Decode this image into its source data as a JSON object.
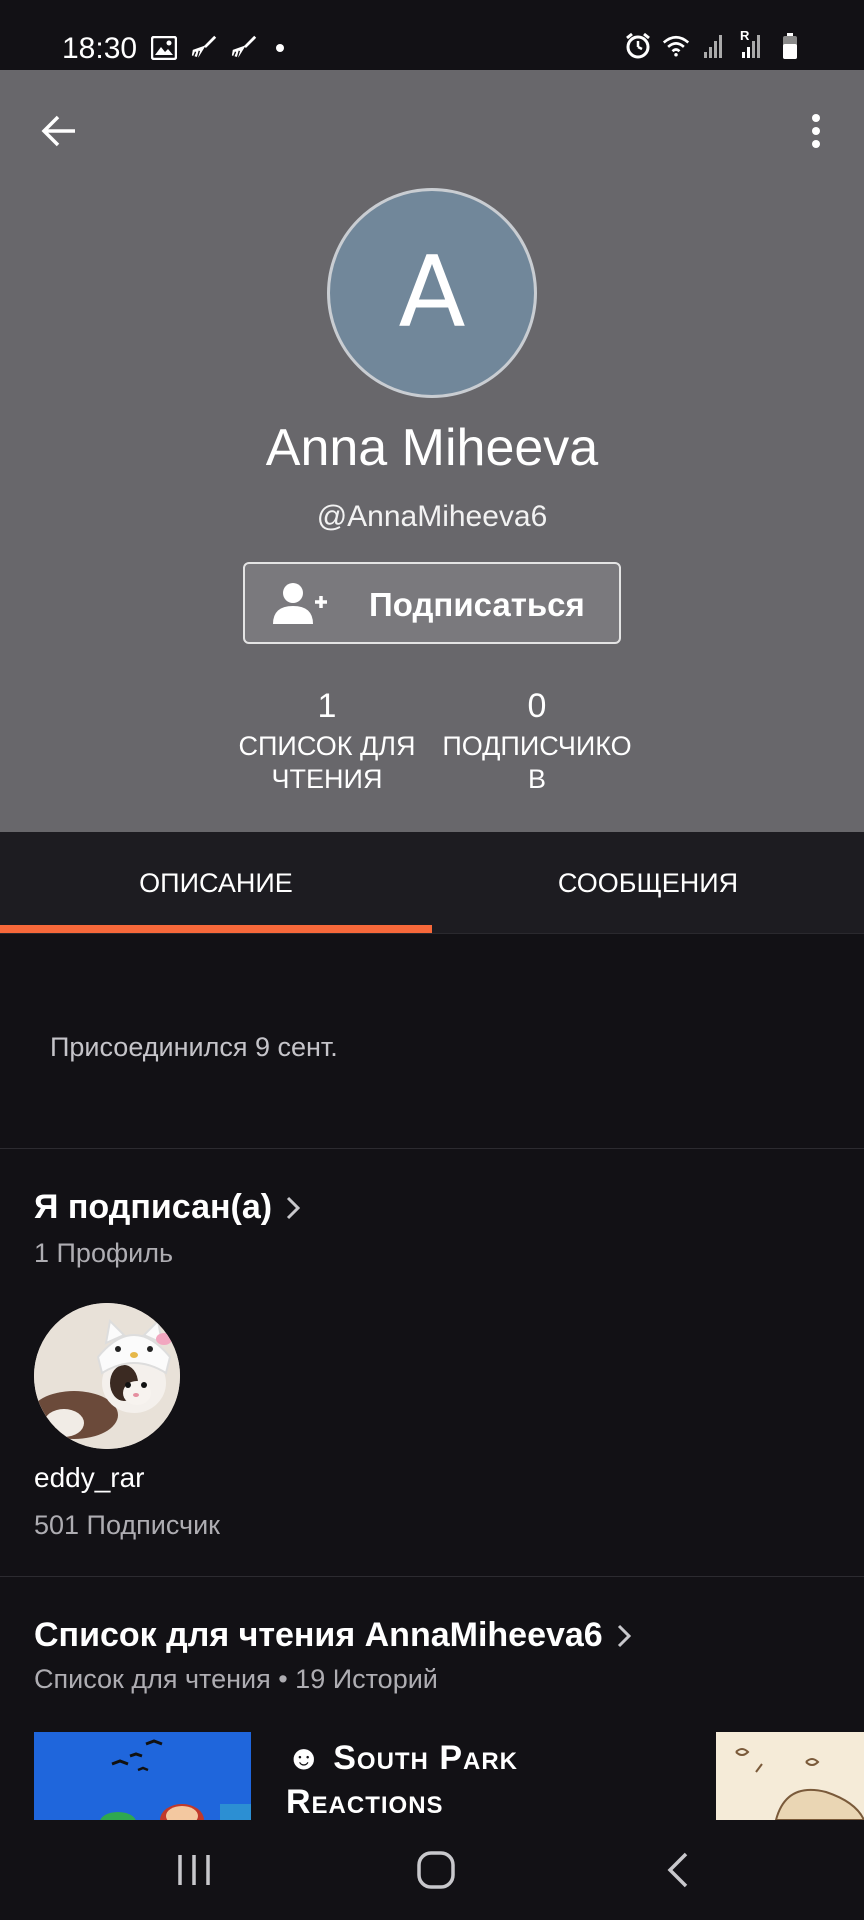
{
  "status_bar": {
    "time": "18:30",
    "left_icons": [
      "image-icon",
      "broom-icon",
      "broom-icon",
      "dot-icon"
    ],
    "right_icons": [
      "alarm-icon",
      "wifi-icon",
      "signal-icon",
      "signal-roaming-icon",
      "battery-icon"
    ],
    "roaming_label": "R"
  },
  "header": {
    "background_color": "#68676b",
    "avatar_initial": "A",
    "avatar_color": "#71879a",
    "name": "Anna Miheeva",
    "handle": "@AnnaMiheeva6",
    "follow_button_label": "Подписаться",
    "stats": [
      {
        "value": "1",
        "label": "СПИСОК ДЛЯ\nЧТЕНИЯ"
      },
      {
        "value": "0",
        "label": "ПОДПИСЧИКО\nВ"
      }
    ]
  },
  "tabs": {
    "items": [
      {
        "label": "ОПИСАНИЕ",
        "active": true
      },
      {
        "label": "СООБЩЕНИЯ",
        "active": false
      }
    ],
    "accent_color": "#f7683a"
  },
  "about": {
    "joined": "Присоединился 9 сент."
  },
  "following": {
    "title": "Я подписан(а)",
    "subtitle": "1 Профиль",
    "profiles": [
      {
        "username": "eddy_rar",
        "followers": "501 Подписчик"
      }
    ]
  },
  "reading_list": {
    "title": "Список для чтения AnnaMiheeva6",
    "subtitle": "Список для чтения • 19 Историй",
    "stories": [
      {
        "title_line1": "☻ South Park",
        "title_line2": "Reactions"
      }
    ]
  },
  "nav_bar": {
    "buttons": [
      "recents-icon",
      "home-icon",
      "back-icon"
    ]
  }
}
